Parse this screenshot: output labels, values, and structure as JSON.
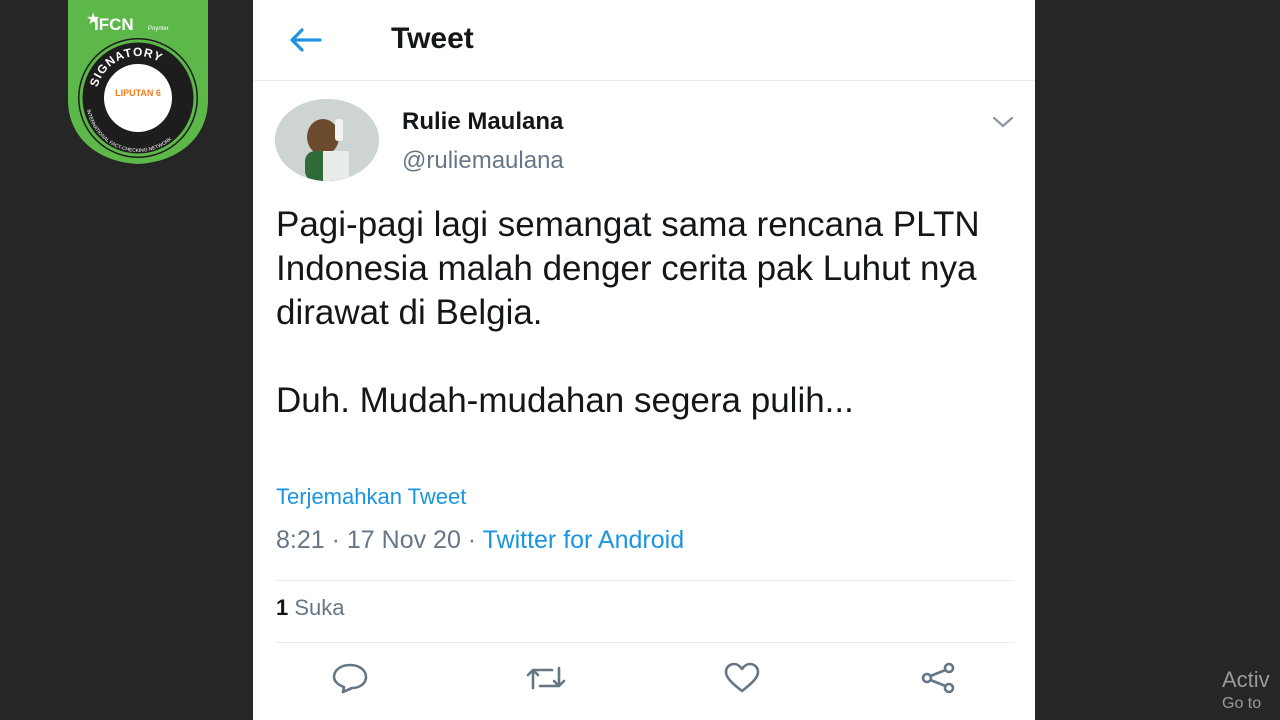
{
  "header": {
    "title": "Tweet"
  },
  "tweet": {
    "author_name": "Rulie Maulana",
    "author_handle": "@ruliemaulana",
    "text_p1": "Pagi-pagi lagi semangat sama rencana PLTN Indonesia malah denger cerita pak Luhut nya dirawat di Belgia.",
    "text_p2": "Duh. Mudah-mudahan segera pulih...",
    "translate_label": "Terjemahkan Tweet",
    "time": "8:21",
    "date": "17 Nov 20",
    "source": "Twitter for Android",
    "likes_count": "1",
    "likes_label": "Suka"
  },
  "actions": [
    "reply-icon",
    "retweet-icon",
    "like-icon",
    "share-icon"
  ],
  "badge": {
    "top_text": "IFCN",
    "top_sub": "Poynter",
    "ring_text": "SIGNATORY",
    "side_text": "INTERNATIONAL FACT-CHECKING NETWORK",
    "center_text": "LIPUTAN 6"
  },
  "watermark": {
    "line1": "Activ",
    "line2": "Go to"
  },
  "colors": {
    "link": "#1b95e0",
    "muted": "#657786",
    "badge_green": "#5cb848"
  }
}
